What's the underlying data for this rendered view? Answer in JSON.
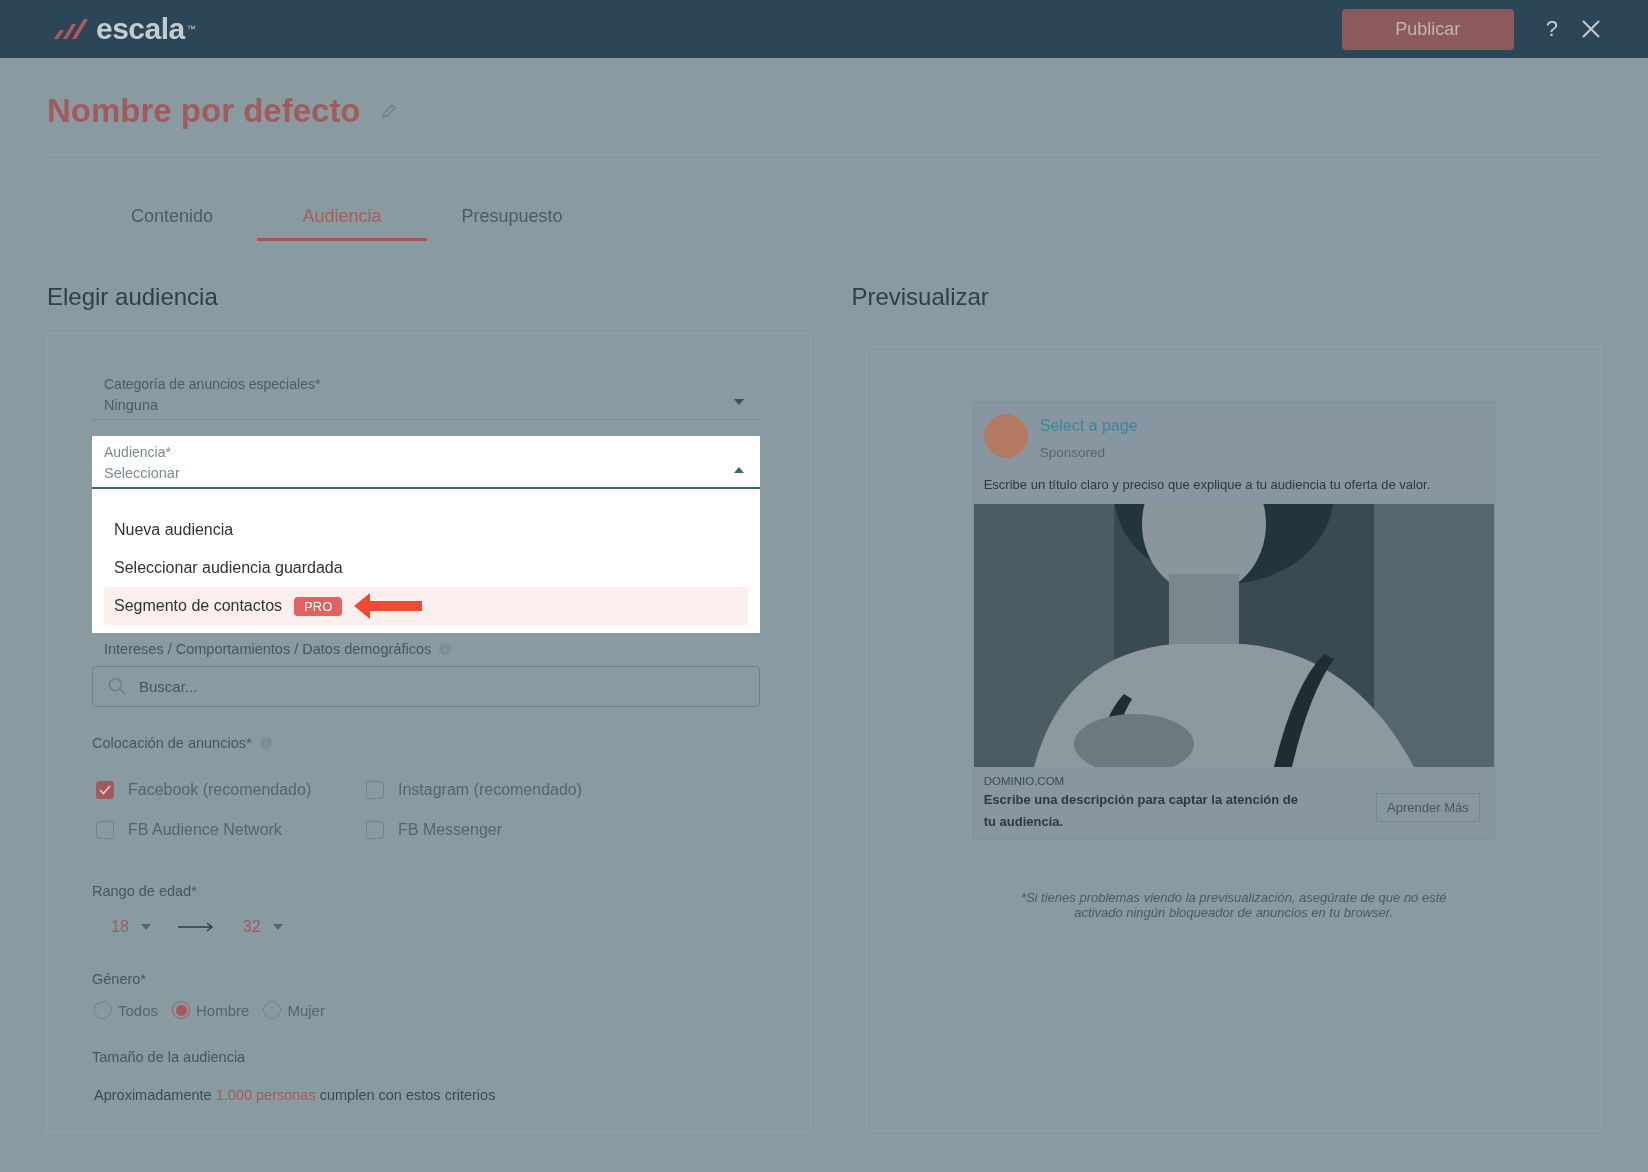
{
  "header": {
    "logo": "escala",
    "trademark": "™",
    "publish_button": "Publicar",
    "help_button": "?"
  },
  "title": "Nombre por defecto",
  "tabs": [
    {
      "label": "Contenido",
      "selected": false
    },
    {
      "label": "Audiencia",
      "selected": true
    },
    {
      "label": "Presupuesto",
      "selected": false
    }
  ],
  "audience_panel": {
    "heading": "Elegir audiencia",
    "category_field": {
      "label": "Categoría de anuncios especiales*",
      "value": "Ninguna"
    },
    "audience_field": {
      "label": "Audiencia*",
      "value": "Seleccionar",
      "expanded": true,
      "options": [
        {
          "label": "Nueva audiencia",
          "selected": false
        },
        {
          "label": "Seleccionar audiencia guardada",
          "selected": false
        },
        {
          "label": "Segmento de contactos",
          "badge": "PRO",
          "selected": true,
          "pointer_arrow": true
        }
      ]
    },
    "interests": {
      "label": "Intereses / Comportamientos / Datos demográficos",
      "placeholder": "Buscar..."
    },
    "placements": {
      "label": "Colocación de anuncios*",
      "options": [
        {
          "label": "Facebook (recomendado)",
          "checked": true
        },
        {
          "label": "Instagram (recomendado)",
          "checked": false
        },
        {
          "label": "FB Audience Network",
          "checked": false
        },
        {
          "label": "FB Messenger",
          "checked": false
        }
      ]
    },
    "age_range": {
      "label": "Rango de edad*",
      "from": "18",
      "to": "32"
    },
    "gender": {
      "label": "Género*",
      "options": [
        {
          "label": "Todos",
          "selected": false
        },
        {
          "label": "Hombre",
          "selected": true
        },
        {
          "label": "Mujer",
          "selected": false
        }
      ]
    },
    "audience_size": {
      "label": "Tamaño de la audiencia",
      "text_before": "Aproximadamente",
      "highlight": "1.000 personas",
      "text_after": "cumplen con estos criterios"
    }
  },
  "preview_panel": {
    "heading": "Previsualizar",
    "ad": {
      "page_name": "Select a page",
      "sponsored": "Sponsored",
      "headline": "Escribe un título claro y preciso que explique a tu audiencia tu oferta de valor.",
      "domain": "DOMINIO.COM",
      "description": "Escribe una descripción para captar la atención de tu audiencia.",
      "cta_button": "Aprender Más"
    },
    "note": "*Si tienes problemas viendo la previsualización, asegúrate de que no esté activado ningún bloqueador de anuncios en tu browser."
  }
}
